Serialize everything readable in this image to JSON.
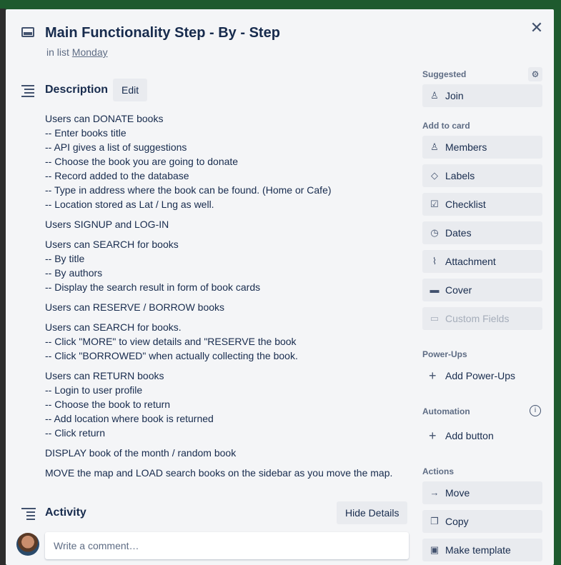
{
  "card": {
    "title": "Main Functionality Step - By - Step",
    "in_list_prefix": "in list",
    "list_name": "Monday"
  },
  "description": {
    "heading": "Description",
    "edit_label": "Edit",
    "paragraphs": [
      [
        "Users can DONATE books",
        "-- Enter books title",
        "-- API gives a list of suggestions",
        "-- Choose the book you are going to donate",
        "-- Record added to the database",
        "-- Type in address where the book can be found. (Home or Cafe)",
        "-- Location stored as Lat / Lng as well."
      ],
      [
        "Users SIGNUP and LOG-IN"
      ],
      [
        "Users can SEARCH for books",
        "-- By title",
        "-- By authors",
        "-- Display the search result in form of book cards"
      ],
      [
        "Users can RESERVE / BORROW books"
      ],
      [
        "Users can SEARCH for books.",
        "-- Click \"MORE\" to view details and \"RESERVE the book",
        "-- Click \"BORROWED\" when actually collecting the book."
      ],
      [
        "Users can RETURN books",
        "-- Login to user profile",
        "-- Choose the book to return",
        "-- Add location where book is returned",
        "-- Click return"
      ],
      [
        "DISPLAY book of the month / random book"
      ],
      [
        "MOVE the map and LOAD search books on the sidebar as you move the map."
      ]
    ]
  },
  "activity": {
    "heading": "Activity",
    "hide_details_label": "Hide Details",
    "comment_placeholder": "Write a comment…"
  },
  "sidebar": {
    "suggested_label": "Suggested",
    "join_label": "Join",
    "add_to_card_label": "Add to card",
    "add_to_card": [
      {
        "label": "Members",
        "icon": "person-icon"
      },
      {
        "label": "Labels",
        "icon": "tag-icon"
      },
      {
        "label": "Checklist",
        "icon": "checklist-icon"
      },
      {
        "label": "Dates",
        "icon": "clock-icon"
      },
      {
        "label": "Attachment",
        "icon": "paperclip-icon"
      },
      {
        "label": "Cover",
        "icon": "cover-icon"
      },
      {
        "label": "Custom Fields",
        "icon": "custom-fields-icon"
      }
    ],
    "powerups_label": "Power-Ups",
    "add_powerups_label": "Add Power-Ups",
    "automation_label": "Automation",
    "add_button_label": "Add button",
    "actions_label": "Actions",
    "actions": [
      {
        "label": "Move",
        "icon": "arrow-right-icon"
      },
      {
        "label": "Copy",
        "icon": "copy-icon"
      },
      {
        "label": "Make template",
        "icon": "template-icon"
      }
    ]
  }
}
